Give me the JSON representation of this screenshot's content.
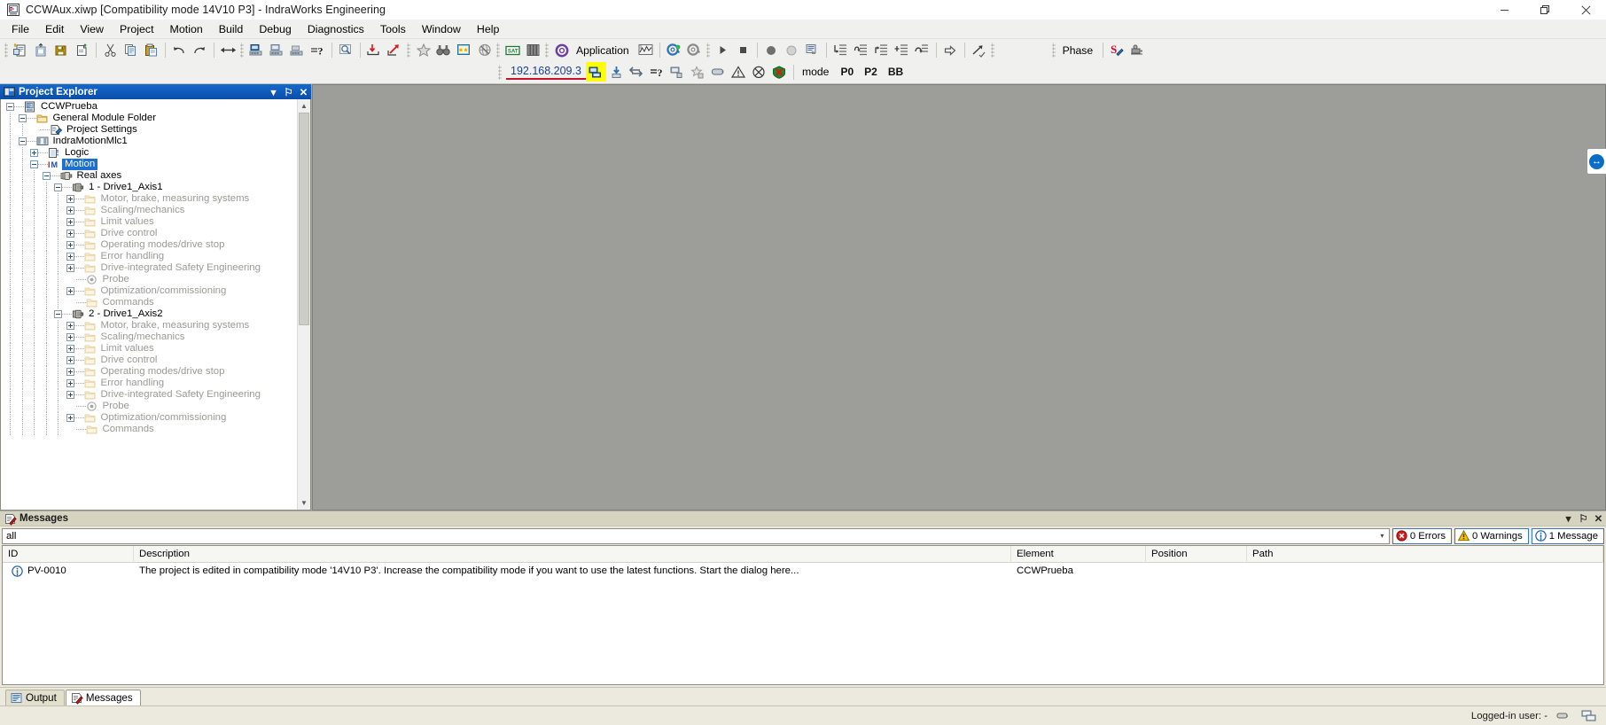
{
  "window": {
    "title": "CCWAux.xiwp [Compatibility mode 14V10 P3] - IndraWorks Engineering",
    "app_icon": "indraworks-icon",
    "minimize": "–",
    "maximize": "❐",
    "close": "✕"
  },
  "menubar": {
    "items": [
      {
        "label": "File"
      },
      {
        "label": "Edit"
      },
      {
        "label": "View"
      },
      {
        "label": "Project"
      },
      {
        "label": "Motion"
      },
      {
        "label": "Build"
      },
      {
        "label": "Debug"
      },
      {
        "label": "Diagnostics"
      },
      {
        "label": "Tools"
      },
      {
        "label": "Window"
      },
      {
        "label": "Help"
      }
    ]
  },
  "toolbar": {
    "row1": [
      {
        "kind": "grip"
      },
      {
        "kind": "icon",
        "name": "new-project-icon"
      },
      {
        "kind": "icon",
        "name": "open-project-icon"
      },
      {
        "kind": "icon",
        "name": "save-project-icon"
      },
      {
        "kind": "icon",
        "name": "new-file-icon"
      },
      {
        "kind": "sep"
      },
      {
        "kind": "icon",
        "name": "cut-icon"
      },
      {
        "kind": "icon",
        "name": "copy-icon"
      },
      {
        "kind": "icon",
        "name": "paste-icon"
      },
      {
        "kind": "sep"
      },
      {
        "kind": "icon",
        "name": "undo-icon"
      },
      {
        "kind": "icon",
        "name": "redo-icon"
      },
      {
        "kind": "sep"
      },
      {
        "kind": "icon",
        "name": "swap-arrows-icon"
      },
      {
        "kind": "grip"
      },
      {
        "kind": "icon",
        "name": "build-project-icon"
      },
      {
        "kind": "icon",
        "name": "rebuild-project-icon"
      },
      {
        "kind": "icon",
        "name": "clean-project-icon"
      },
      {
        "kind": "icon",
        "name": "check-syntax-icon"
      },
      {
        "kind": "sep"
      },
      {
        "kind": "icon",
        "name": "find-in-project-icon"
      },
      {
        "kind": "sep"
      },
      {
        "kind": "icon",
        "name": "download-to-target-icon"
      },
      {
        "kind": "icon",
        "name": "upload-from-target-icon"
      },
      {
        "kind": "grip"
      },
      {
        "kind": "icon",
        "name": "favorite-star-icon"
      },
      {
        "kind": "icon",
        "name": "find-binoculars-icon"
      },
      {
        "kind": "icon",
        "name": "bookmark-list-icon"
      },
      {
        "kind": "icon",
        "name": "cancel-globe-icon"
      },
      {
        "kind": "grip"
      },
      {
        "kind": "icon",
        "name": "sat-module-icon"
      },
      {
        "kind": "icon",
        "name": "library-icon"
      },
      {
        "kind": "grip"
      },
      {
        "kind": "icon",
        "name": "application-gear-icon"
      },
      {
        "kind": "label",
        "text": "Application"
      },
      {
        "kind": "icon",
        "name": "trace-icon"
      },
      {
        "kind": "sep"
      },
      {
        "kind": "icon",
        "name": "login-icon"
      },
      {
        "kind": "icon",
        "name": "logout-icon"
      },
      {
        "kind": "grip"
      },
      {
        "kind": "icon",
        "name": "run-icon"
      },
      {
        "kind": "icon",
        "name": "stop-icon"
      },
      {
        "kind": "sep"
      },
      {
        "kind": "icon",
        "name": "breakpoint-icon"
      },
      {
        "kind": "icon",
        "name": "breakpoint-disabled-icon"
      },
      {
        "kind": "icon",
        "name": "breakpoint-list-icon"
      },
      {
        "kind": "sep"
      },
      {
        "kind": "icon",
        "name": "step-into-icon"
      },
      {
        "kind": "icon",
        "name": "step-over-icon"
      },
      {
        "kind": "icon",
        "name": "step-out-icon"
      },
      {
        "kind": "icon",
        "name": "run-to-cursor-icon"
      },
      {
        "kind": "icon",
        "name": "show-next-statement-icon"
      },
      {
        "kind": "sep"
      },
      {
        "kind": "icon",
        "name": "next-instruction-icon"
      },
      {
        "kind": "sep"
      },
      {
        "kind": "icon",
        "name": "flow-control-icon"
      },
      {
        "kind": "grip"
      },
      {
        "kind": "grip"
      },
      {
        "kind": "label",
        "text": "Phase"
      },
      {
        "kind": "sep"
      },
      {
        "kind": "icon",
        "name": "switch-phase-icon"
      },
      {
        "kind": "icon",
        "name": "commissioning-icon"
      }
    ],
    "row2": {
      "grip": true,
      "ip_address": "192.168.209.3",
      "icons": [
        {
          "name": "connect-target-icon",
          "highlight": true
        },
        {
          "name": "download-firmware-icon"
        },
        {
          "name": "compare-target-icon"
        },
        {
          "name": "compare-help-icon"
        },
        {
          "name": "disconnect-target-icon"
        },
        {
          "name": "add-favorite-target-icon"
        },
        {
          "name": "device-icon"
        },
        {
          "name": "diagnostics-warning-icon"
        },
        {
          "name": "clear-error-icon"
        },
        {
          "name": "reset-error-icon"
        }
      ],
      "mode_label": "mode",
      "mode_values": [
        "P0",
        "P2",
        "BB"
      ]
    }
  },
  "project_explorer": {
    "title": "Project Explorer",
    "icon": "project-explorer-icon",
    "caption_buttons": [
      {
        "name": "dropdown-menu-button",
        "glyph": "▾"
      },
      {
        "name": "auto-hide-pin-button",
        "glyph": "⚐"
      },
      {
        "name": "close-panel-button",
        "glyph": "✕"
      }
    ],
    "tree": [
      {
        "depth": 0,
        "expander": "minus",
        "icon": "project-icon",
        "label": "CCWPrueba",
        "dim": false,
        "selected": false
      },
      {
        "depth": 1,
        "expander": "minus",
        "icon": "folder-icon",
        "label": "General Module Folder",
        "dim": false,
        "selected": false
      },
      {
        "depth": 2,
        "expander": "none",
        "icon": "settings-icon",
        "label": "Project Settings",
        "dim": false,
        "selected": false
      },
      {
        "depth": 1,
        "expander": "minus",
        "icon": "plc-icon",
        "label": "IndraMotionMlc1",
        "dim": false,
        "selected": false
      },
      {
        "depth": 2,
        "expander": "plus",
        "icon": "logic-icon",
        "label": "Logic",
        "dim": false,
        "selected": false
      },
      {
        "depth": 2,
        "expander": "minus",
        "icon": "motion-icon",
        "label": "Motion",
        "dim": false,
        "selected": true
      },
      {
        "depth": 3,
        "expander": "minus",
        "icon": "axes-icon",
        "label": "Real axes",
        "dim": false,
        "selected": false
      },
      {
        "depth": 4,
        "expander": "minus",
        "icon": "axis-icon",
        "label": "1 - Drive1_Axis1",
        "dim": false,
        "selected": false
      },
      {
        "depth": 5,
        "expander": "plus",
        "icon": "folder-icon",
        "label": "Motor, brake, measuring systems",
        "dim": true,
        "selected": false
      },
      {
        "depth": 5,
        "expander": "plus",
        "icon": "folder-icon",
        "label": "Scaling/mechanics",
        "dim": true,
        "selected": false
      },
      {
        "depth": 5,
        "expander": "plus",
        "icon": "folder-icon",
        "label": "Limit values",
        "dim": true,
        "selected": false
      },
      {
        "depth": 5,
        "expander": "plus",
        "icon": "folder-icon",
        "label": "Drive control",
        "dim": true,
        "selected": false
      },
      {
        "depth": 5,
        "expander": "plus",
        "icon": "folder-icon",
        "label": "Operating modes/drive stop",
        "dim": true,
        "selected": false
      },
      {
        "depth": 5,
        "expander": "plus",
        "icon": "folder-icon",
        "label": "Error handling",
        "dim": true,
        "selected": false
      },
      {
        "depth": 5,
        "expander": "plus",
        "icon": "folder-icon",
        "label": "Drive-integrated Safety Engineering",
        "dim": true,
        "selected": false
      },
      {
        "depth": 5,
        "expander": "none",
        "icon": "probe-icon",
        "label": "Probe",
        "dim": true,
        "selected": false
      },
      {
        "depth": 5,
        "expander": "plus",
        "icon": "folder-icon",
        "label": "Optimization/commissioning",
        "dim": true,
        "selected": false
      },
      {
        "depth": 5,
        "expander": "none",
        "icon": "folder-icon",
        "label": "Commands",
        "dim": true,
        "selected": false
      },
      {
        "depth": 4,
        "expander": "minus",
        "icon": "axis-icon",
        "label": "2 - Drive1_Axis2",
        "dim": false,
        "selected": false
      },
      {
        "depth": 5,
        "expander": "plus",
        "icon": "folder-icon",
        "label": "Motor, brake, measuring systems",
        "dim": true,
        "selected": false
      },
      {
        "depth": 5,
        "expander": "plus",
        "icon": "folder-icon",
        "label": "Scaling/mechanics",
        "dim": true,
        "selected": false
      },
      {
        "depth": 5,
        "expander": "plus",
        "icon": "folder-icon",
        "label": "Limit values",
        "dim": true,
        "selected": false
      },
      {
        "depth": 5,
        "expander": "plus",
        "icon": "folder-icon",
        "label": "Drive control",
        "dim": true,
        "selected": false
      },
      {
        "depth": 5,
        "expander": "plus",
        "icon": "folder-icon",
        "label": "Operating modes/drive stop",
        "dim": true,
        "selected": false
      },
      {
        "depth": 5,
        "expander": "plus",
        "icon": "folder-icon",
        "label": "Error handling",
        "dim": true,
        "selected": false
      },
      {
        "depth": 5,
        "expander": "plus",
        "icon": "folder-icon",
        "label": "Drive-integrated Safety Engineering",
        "dim": true,
        "selected": false
      },
      {
        "depth": 5,
        "expander": "none",
        "icon": "probe-icon",
        "label": "Probe",
        "dim": true,
        "selected": false
      },
      {
        "depth": 5,
        "expander": "plus",
        "icon": "folder-icon",
        "label": "Optimization/commissioning",
        "dim": true,
        "selected": false
      },
      {
        "depth": 5,
        "expander": "none",
        "icon": "folder-icon",
        "label": "Commands",
        "dim": true,
        "selected": false
      }
    ]
  },
  "edge_tab": {
    "name": "teamviewer-panel-tab",
    "glyph": "↔"
  },
  "messages_panel": {
    "title": "Messages",
    "icon": "messages-icon",
    "caption_buttons": [
      {
        "name": "dropdown-menu-button",
        "glyph": "▾"
      },
      {
        "name": "auto-hide-pin-button",
        "glyph": "⚐"
      },
      {
        "name": "close-panel-button",
        "glyph": "✕"
      }
    ],
    "filter": {
      "value": "all",
      "placeholder": "all",
      "caret": "▾"
    },
    "badges": [
      {
        "name": "errors-badge",
        "icon": "error-icon",
        "label": "0 Errors"
      },
      {
        "name": "warnings-badge",
        "icon": "warning-icon",
        "label": "0 Warnings"
      },
      {
        "name": "messages-badge",
        "icon": "info-icon",
        "label": "1 Message"
      }
    ],
    "columns": [
      "ID",
      "Description",
      "Element",
      "Position",
      "Path"
    ],
    "rows": [
      {
        "icon": "info-icon",
        "id": "PV-0010",
        "description": "The project is edited in compatibility mode '14V10 P3'. Increase the compatibility mode if you want to use the latest functions. Start the dialog here...",
        "element": "CCWPrueba",
        "position": "",
        "path": ""
      }
    ]
  },
  "bottom_tabs": [
    {
      "name": "tab-output",
      "icon": "output-icon",
      "label": "Output",
      "active": false
    },
    {
      "name": "tab-messages",
      "icon": "messages-icon",
      "label": "Messages",
      "active": true
    }
  ],
  "statusbar": {
    "user_label": "Logged-in user: -",
    "icons": [
      {
        "name": "connection-status-icon"
      },
      {
        "name": "target-status-icon"
      }
    ]
  },
  "colors": {
    "dock_caption": "#0a55b8",
    "selection": "#1f6fd0",
    "editor_background": "#9d9d9a",
    "panel_background": "#eceade",
    "highlight_yellow": "#ffff00",
    "ip_underline": "#c8102e",
    "ip_text": "#1b3f8f"
  }
}
